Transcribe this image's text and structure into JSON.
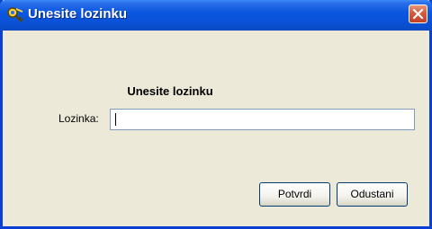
{
  "window": {
    "title": "Unesite lozinku",
    "app_icon": "key-chain-icon",
    "close_icon": "close-icon",
    "colors": {
      "titlebar": "#0A52D8",
      "close": "#D65A3E",
      "body": "#ECE9D8"
    }
  },
  "dialog": {
    "heading": "Unesite lozinku",
    "password_label": "Lozinka:",
    "password_value": ""
  },
  "buttons": {
    "confirm_label": "Potvrdi",
    "cancel_label": "Odustani"
  }
}
